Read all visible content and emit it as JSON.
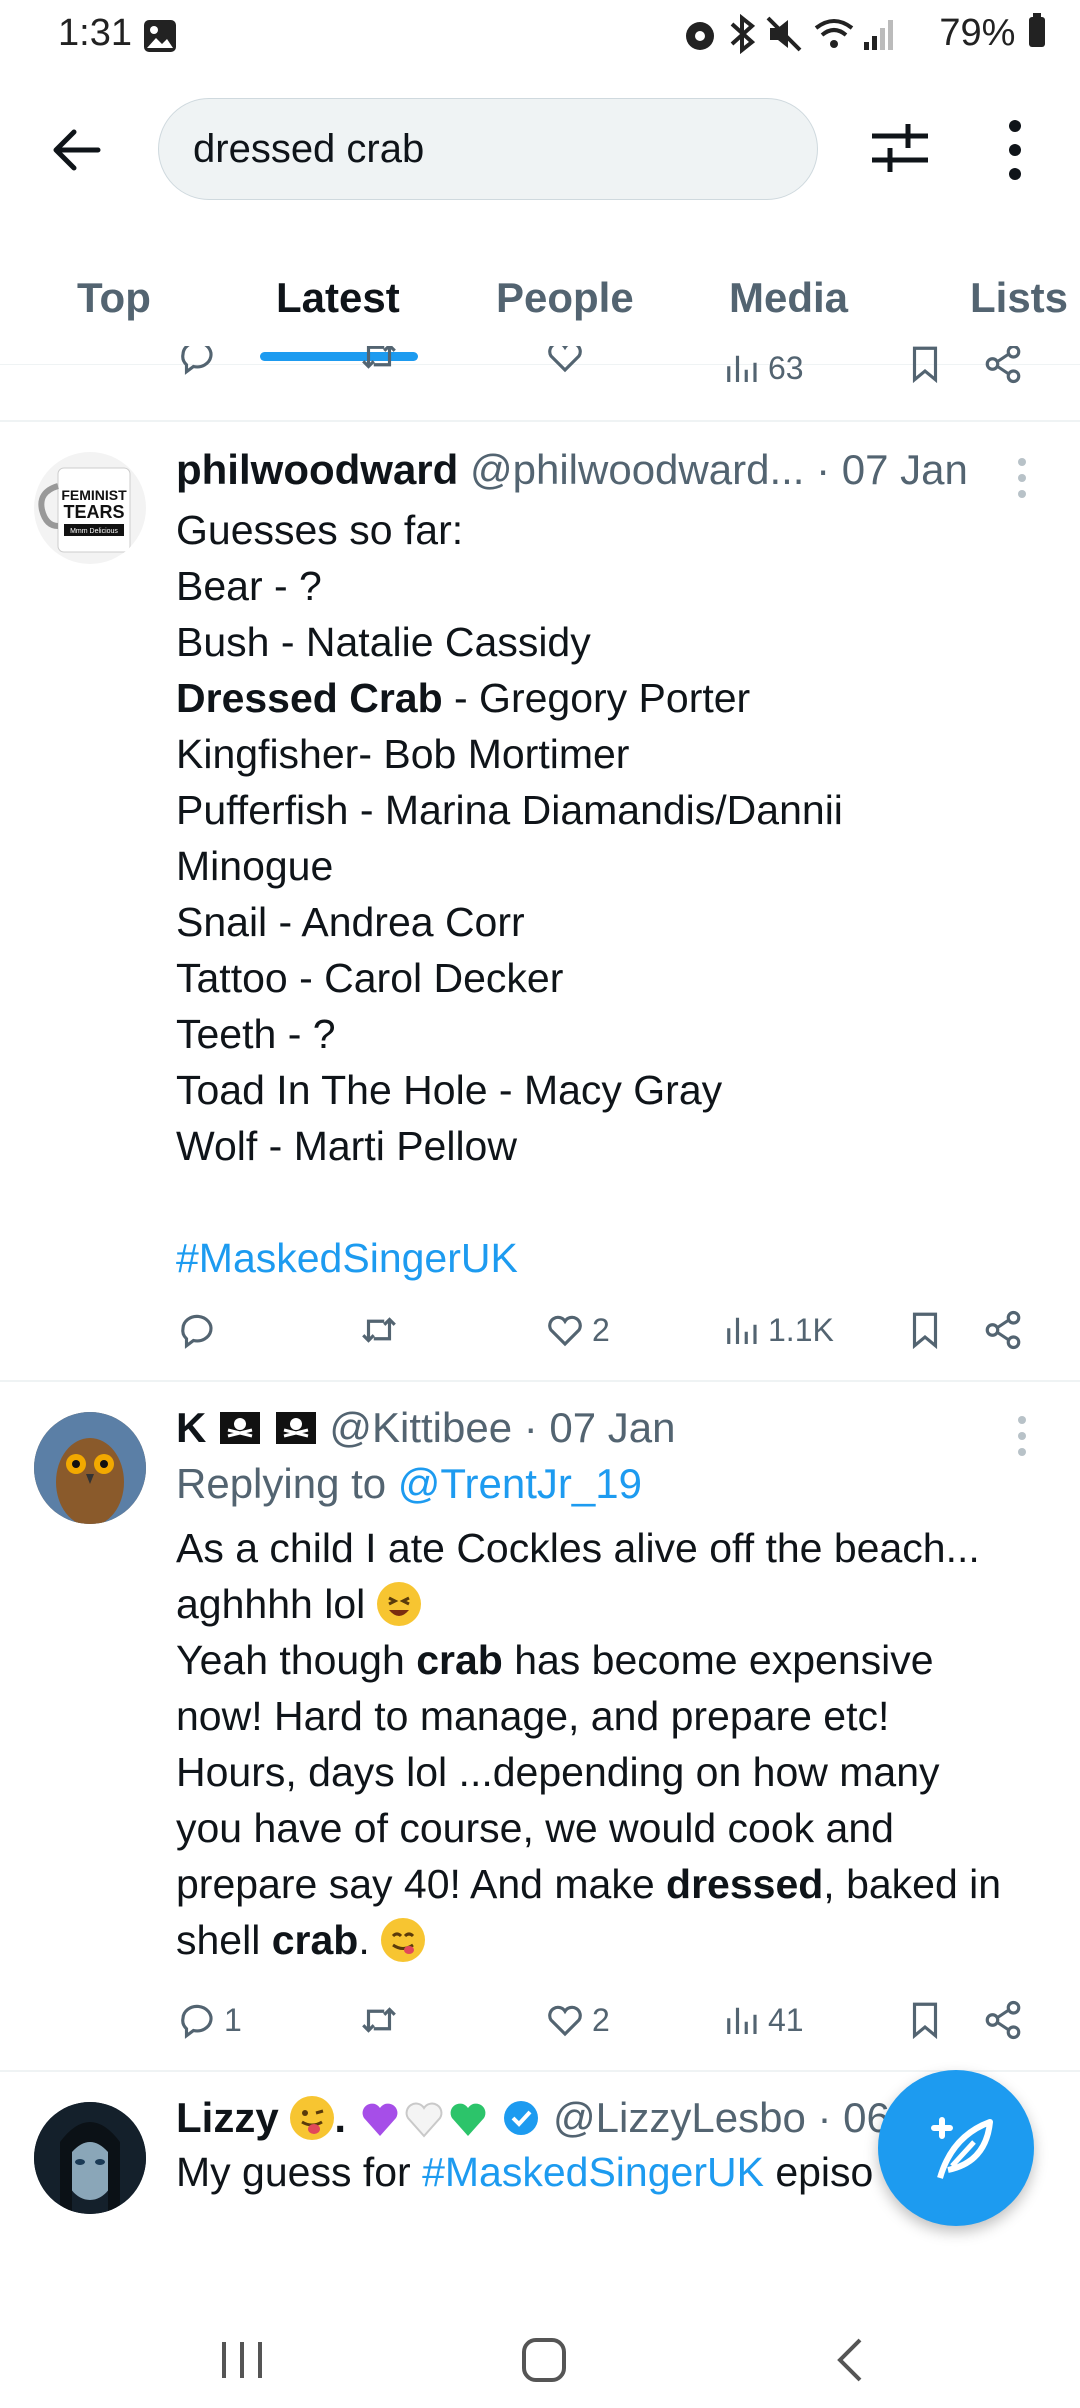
{
  "status_bar": {
    "time": "1:31",
    "battery": "79%",
    "icons": [
      "image-icon",
      "alarm-icon",
      "bluetooth-icon",
      "mute-icon",
      "wifi-icon",
      "signal-icon",
      "battery-icon"
    ]
  },
  "search": {
    "query": "dressed crab"
  },
  "tabs": [
    {
      "label": "Top",
      "active": false
    },
    {
      "label": "Latest",
      "active": true
    },
    {
      "label": "People",
      "active": false
    },
    {
      "label": "Media",
      "active": false
    },
    {
      "label": "Lists",
      "active": false
    }
  ],
  "prev_tweet_actions": {
    "views": "63"
  },
  "tweet1": {
    "display_name": "philwoodward",
    "handle": "@philwoodward...",
    "date": "· 07 Jan",
    "avatar_text": [
      "FEMINIST",
      "TEARS",
      "Mmm Delicious"
    ],
    "lines": [
      "Guesses so far:",
      "Bear - ?",
      "Bush - Natalie Cassidy",
      "Dressed Crab",
      " - Gregory Porter",
      "Kingfisher- Bob Mortimer",
      "Pufferfish - Marina Diamandis/Dannii",
      "Minogue",
      "Snail - Andrea Corr",
      "Tattoo - Carol Decker",
      "Teeth - ?",
      "Toad In The Hole - Macy Gray",
      "Wolf - Marti Pellow"
    ],
    "hashtag": "#MaskedSingerUK",
    "likes": "2",
    "views": "1.1K"
  },
  "tweet2": {
    "display_name": "K",
    "handle": "@Kittibee",
    "date": "· 07 Jan",
    "replying_prefix": "Replying to",
    "replying_to": "@TrentJr_19",
    "l1": "As a child I ate Cockles alive off the beach...",
    "l2": "aghhhh lol",
    "l3a": "Yeah though ",
    "l3b": "crab",
    "l3c": " has become expensive",
    "l4": "now! Hard to manage, and prepare etc!",
    "l5": "Hours, days lol ...depending on how many",
    "l6": "you have of course, we would cook and",
    "l7a": "prepare say 40! And make ",
    "l7b": "dressed",
    "l7c": ", baked in",
    "l8a": "shell ",
    "l8b": "crab",
    "l8c": ".",
    "replies": "1",
    "likes": "2",
    "views": "41"
  },
  "tweet3": {
    "display_name": "Lizzy",
    "name_suffix": ".",
    "handle": "@LizzyLesbo",
    "date": "· 06",
    "text_a": "My guess for ",
    "hashtag": "#MaskedSingerUK",
    "text_b": " episo"
  },
  "colors": {
    "accent": "#1d9bf0",
    "text": "#0f1419",
    "muted": "#536471"
  }
}
